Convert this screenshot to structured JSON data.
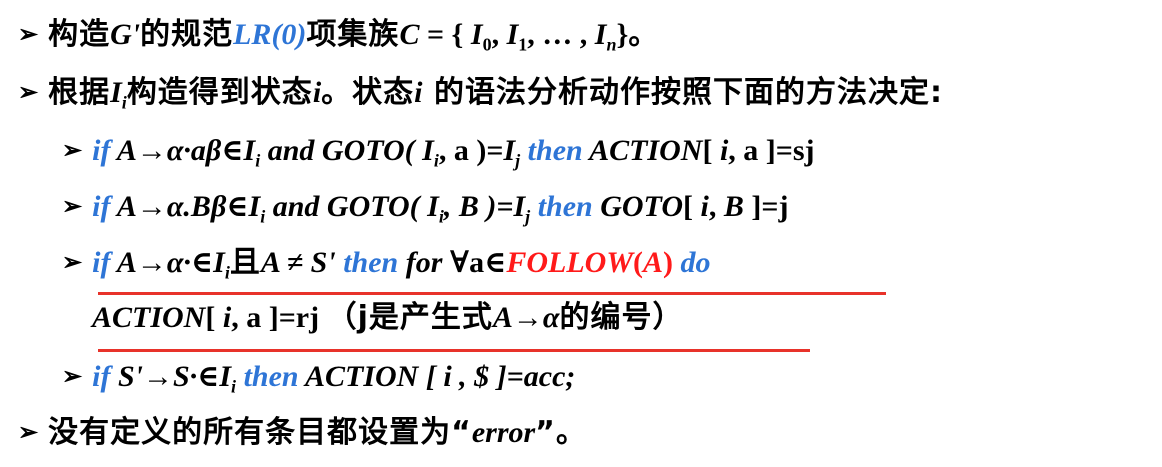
{
  "bullet_glyph": "➢",
  "line1": {
    "t1": "构造",
    "t2": "G'",
    "t3": "的规范",
    "t4": "LR(0)",
    "t5": "项集族",
    "t6": "C",
    "t7": " = { ",
    "t8": "I",
    "t9": "0",
    "t10": ", ",
    "t11": "I",
    "t12": "1",
    "t13": ", … , ",
    "t14": "I",
    "t15": "n",
    "t16": "}",
    "t17": "。"
  },
  "line2": {
    "t1": "根据",
    "t2": "I",
    "t3": "i",
    "t4": "构造得到状态",
    "t5": "i",
    "t6": "。状态",
    "t7": "i",
    "t8": " 的语法分析动作按照下面的方法决定:"
  },
  "line3": {
    "t1": "if",
    "t2": " A→α·aβ∈",
    "t3": "I",
    "t4": "i",
    "t5": " and GOTO( ",
    "t6": "I",
    "t7": "i",
    "t8": ", a )=",
    "t9": "I",
    "t10": "j",
    "t11": " then",
    "t12": " ACTION",
    "t13": "[ ",
    "t14": "i",
    "t15": ", a ]=sj"
  },
  "line4": {
    "t1": "if",
    "t2": " A→α.Bβ∈",
    "t3": "I",
    "t4": "i",
    "t5": " and GOTO( ",
    "t6": "I",
    "t7": "i",
    "t8": ", B )=",
    "t9": "I",
    "t10": "j",
    "t11": " then",
    "t12": " GOTO",
    "t13": "[ ",
    "t14": "i",
    "t15": ", ",
    "t16": "B",
    "t17": " ]=j"
  },
  "line5": {
    "t1": "if",
    "t2": " A→α·∈",
    "t3": "I",
    "t4": "i",
    "t5": "且",
    "t6": "A ≠ S'",
    "t7": " then",
    "t8": " for ",
    "t9": "∀a∈",
    "t10": "FOLLOW",
    "t11": "(",
    "t12": "A",
    "t13": ")",
    "t14": " do"
  },
  "line6": {
    "t1": "ACTION",
    "t2": "[ ",
    "t3": "i",
    "t4": ", a ]=rj ",
    "t5": "（j是产生式",
    "t6": "A→α",
    "t7": "的编号）"
  },
  "line7": {
    "t1": "if",
    "t2": " S'→S·∈",
    "t3": "I",
    "t4": "i",
    "t5": " then",
    "t6": " ACTION [ ",
    "t7": "i",
    "t8": " , $ ]=acc;"
  },
  "line8": {
    "t1": "没有定义的所有条目都设置为“",
    "t2": "error",
    "t3": "”。"
  },
  "colors": {
    "keyword": "#2e75d6",
    "highlight": "#ff1a1a",
    "underline": "#e8322a",
    "text": "#000000"
  }
}
